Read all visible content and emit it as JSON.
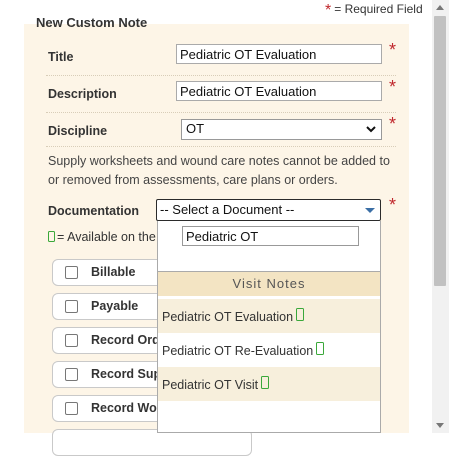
{
  "required_legend": {
    "star": "*",
    "text": "= Required Field"
  },
  "section_title": "New Custom Note",
  "fields": {
    "title": {
      "label": "Title",
      "value": "Pediatric OT Evaluation"
    },
    "description": {
      "label": "Description",
      "value": "Pediatric OT Evaluation"
    },
    "discipline": {
      "label": "Discipline",
      "value": "OT"
    },
    "required_star": "*"
  },
  "note": "Supply worksheets and wound care notes cannot be added to or removed from assessments, care plans or orders.",
  "documentation": {
    "label": "Documentation",
    "placeholder": "-- Select a Document --"
  },
  "available_text": "= Available on the",
  "checkboxes": [
    {
      "label": "Billable"
    },
    {
      "label": "Payable"
    },
    {
      "label": "Record Ord"
    },
    {
      "label": "Record Sup"
    },
    {
      "label": "Record Wou"
    }
  ],
  "dropdown": {
    "search_value": "Pediatric OT",
    "group_label": "Visit Notes",
    "items": [
      {
        "label": "Pediatric OT Evaluation"
      },
      {
        "label": "Pediatric OT Re-Evaluation"
      },
      {
        "label": "Pediatric OT Visit"
      }
    ]
  },
  "colors": {
    "accent_required": "#c0282d",
    "panel_bg": "#fdf5e7",
    "group_bg": "#f3e4c3",
    "mobile_icon": "#3aa83a"
  }
}
